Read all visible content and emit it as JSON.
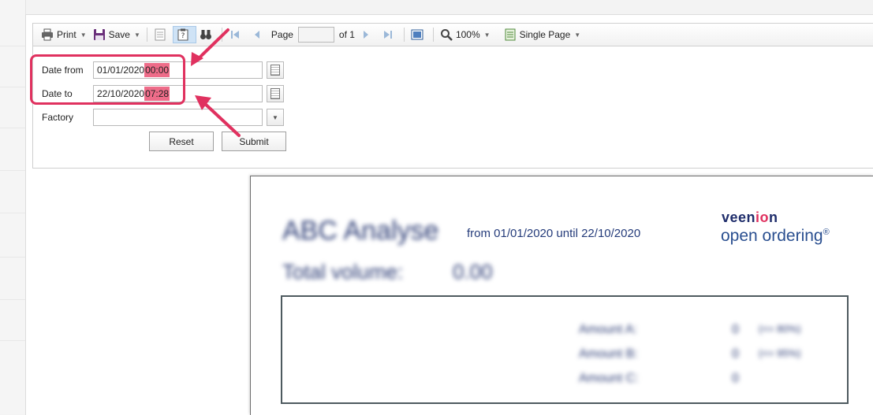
{
  "toolbar": {
    "print_label": "Print",
    "save_label": "Save",
    "page_label": "Page",
    "page_value": "",
    "page_of": "of 1",
    "zoom_label": "100%",
    "layout_label": "Single Page"
  },
  "params": {
    "date_from_label": "Date from",
    "date_from_date": "01/01/2020",
    "date_from_time": "00:00",
    "date_to_label": "Date to",
    "date_to_date": "22/10/2020",
    "date_to_time": "07:28",
    "factory_label": "Factory",
    "factory_value": "",
    "reset_label": "Reset",
    "submit_label": "Submit"
  },
  "report": {
    "title": "ABC Analyse",
    "subtitle": "from 01/01/2020 until 22/10/2020",
    "total_label": "Total volume:",
    "total_value": "0.00",
    "logo_top_a": "veen",
    "logo_top_b": "io",
    "logo_top_c": "n",
    "logo_bottom": "open ordering",
    "logo_reg": "®",
    "amounts": [
      {
        "label": "Amount A:",
        "value": "0",
        "pct": "(<= 80%)"
      },
      {
        "label": "Amount B:",
        "value": "0",
        "pct": "(<= 95%)"
      },
      {
        "label": "Amount C:",
        "value": "0",
        "pct": ""
      }
    ]
  },
  "colors": {
    "highlight": "#ee6c89",
    "annotation": "#e0315f",
    "brand_dark": "#1f2d6b",
    "brand_blue": "#2a4f90"
  }
}
